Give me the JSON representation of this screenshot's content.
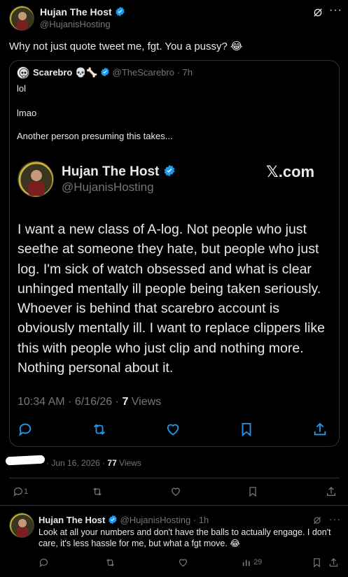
{
  "top_tweet": {
    "author_name": "Hujan The Host",
    "author_handle": "@HujanisHosting",
    "text": "Why not just quote tweet me, fgt. You a pussy? 😂",
    "more_label": "···"
  },
  "quote": {
    "author_name": "Scarebro",
    "author_emojis": "💀🦴",
    "author_handle": "@TheScarebro",
    "time": "· 7h",
    "line1": "lol",
    "line2": "lmao",
    "line3": "Another person presuming this takes..."
  },
  "embedded": {
    "author_name": "Hujan The Host",
    "author_handle": "@HujanisHosting",
    "site_label": "𝕏.com",
    "body": "I want a new class of A-log. Not people who just seethe at someone they hate, but people who just log. I'm sick of watch obsessed and what is clear unhinged mentally ill people being taken seriously. Whoever is behind that scarebro account is obviously mentally ill. I want to replace clippers like this with people who just clip and nothing more. Nothing personal about it.",
    "meta_time": "10:34 AM · 6/16/26 ·",
    "meta_views_count": "7",
    "meta_views_label": "Views"
  },
  "top_meta": {
    "date": "· Jun 16, 2026 ·",
    "views_count": "77",
    "views_label": "Views"
  },
  "top_actions": {
    "reply_count": "1"
  },
  "reply": {
    "author_name": "Hujan The Host",
    "author_handle": "@HujanisHosting",
    "time": "· 1h",
    "text": "Look at all your numbers and don't have the balls to actually engage. I don't care, it's less hassle for me, but what a fgt move. 😂",
    "views": "29",
    "more_label": "···"
  },
  "colors": {
    "verified": "#1d9bf0",
    "border": "#2f3336",
    "muted": "#71767b"
  }
}
